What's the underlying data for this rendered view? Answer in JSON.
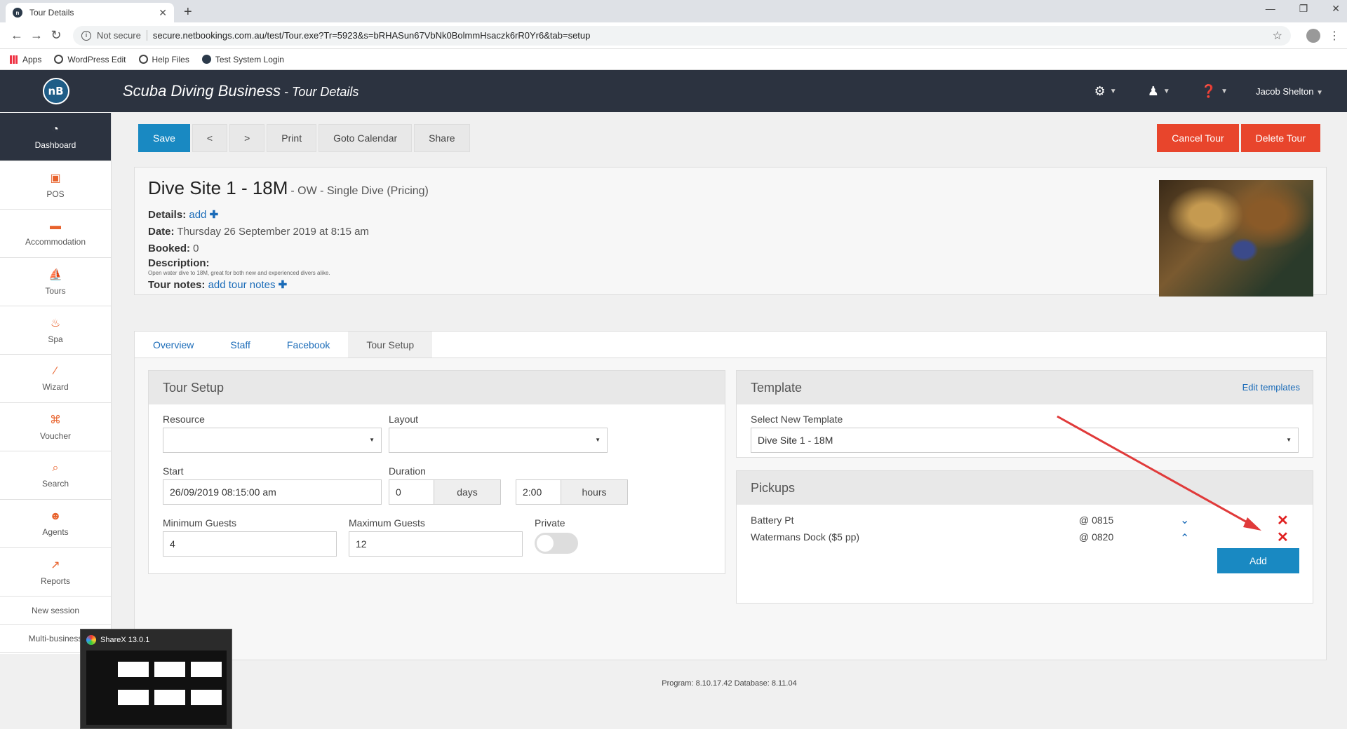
{
  "browser": {
    "tab_title": "Tour Details",
    "url": "secure.netbookings.com.au/test/Tour.exe?Tr=5923&s=bRHASun67VbNk0BolmmHsaczk6rR0Yr6&tab=setup",
    "not_secure": "Not secure",
    "bookmarks": [
      "Apps",
      "WordPress Edit",
      "Help Files",
      "Test System Login"
    ]
  },
  "header": {
    "logo_text": "nB",
    "business": "Scuba Diving Business",
    "separator": " - ",
    "page": "Tour Details",
    "user": "Jacob Shelton"
  },
  "sidebar": {
    "items": [
      {
        "label": "Dashboard",
        "icon": "dashboard-icon"
      },
      {
        "label": "POS",
        "icon": "pos-icon"
      },
      {
        "label": "Accommodation",
        "icon": "bed-icon"
      },
      {
        "label": "Tours",
        "icon": "tours-icon"
      },
      {
        "label": "Spa",
        "icon": "spa-icon"
      },
      {
        "label": "Wizard",
        "icon": "wand-icon"
      },
      {
        "label": "Voucher",
        "icon": "gift-icon"
      },
      {
        "label": "Search",
        "icon": "search-icon"
      },
      {
        "label": "Agents",
        "icon": "agent-icon"
      },
      {
        "label": "Reports",
        "icon": "chart-icon"
      }
    ],
    "new_session": "New session",
    "multi_business": "Multi-business"
  },
  "toolbar": {
    "save": "Save",
    "prev": "<",
    "next": ">",
    "print": "Print",
    "goto_calendar": "Goto Calendar",
    "share": "Share",
    "cancel_tour": "Cancel Tour",
    "delete_tour": "Delete Tour"
  },
  "tour": {
    "name": "Dive Site 1 - 18M",
    "subtitle": "- OW - Single Dive (Pricing)",
    "details_label": "Details:",
    "details_link": "add",
    "date_label": "Date:",
    "date_value": "Thursday 26 September 2019 at 8:15 am",
    "booked_label": "Booked:",
    "booked_value": "0",
    "description_label": "Description:",
    "description_value": "Open water dive to 18M, great for both new and experienced divers alike.",
    "notes_label": "Tour notes:",
    "notes_link": "add tour notes"
  },
  "tabs": [
    "Overview",
    "Staff",
    "Facebook",
    "Tour Setup"
  ],
  "setup": {
    "title": "Tour Setup",
    "resource_label": "Resource",
    "layout_label": "Layout",
    "start_label": "Start",
    "start_value": "26/09/2019 08:15:00 am",
    "duration_label": "Duration",
    "duration_days": "0",
    "days_unit": "days",
    "duration_hours": "2:00",
    "hours_unit": "hours",
    "min_guests_label": "Minimum Guests",
    "min_guests": "4",
    "max_guests_label": "Maximum Guests",
    "max_guests": "12",
    "private_label": "Private"
  },
  "template": {
    "title": "Template",
    "edit_link": "Edit templates",
    "select_label": "Select New Template",
    "selected": "Dive Site 1 - 18M"
  },
  "pickups": {
    "title": "Pickups",
    "rows": [
      {
        "name": "Battery Pt",
        "time": "@ 0815"
      },
      {
        "name": "Watermans Dock ($5 pp)",
        "time": "@ 0820"
      }
    ],
    "add": "Add"
  },
  "footer": "Program: 8.10.17.42 Database: 8.11.04",
  "sharex": {
    "title": "ShareX 13.0.1"
  },
  "colors": {
    "primary": "#1989c2",
    "danger": "#e8452c",
    "header": "#2c3340",
    "annotation_arrow": "#e03a3a"
  }
}
